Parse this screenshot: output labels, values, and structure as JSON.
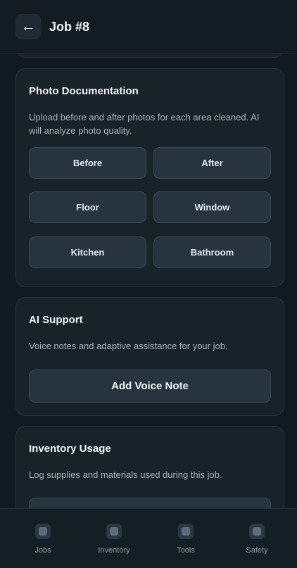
{
  "header": {
    "back_icon": "←",
    "title": "Job #8"
  },
  "photo": {
    "title": "Photo Documentation",
    "description": "Upload before and after photos for each area cleaned. AI will analyze photo quality.",
    "buttons": [
      "Before",
      "After",
      "Floor",
      "Window",
      "Kitchen",
      "Bathroom"
    ]
  },
  "ai": {
    "title": "AI Support",
    "description": "Voice notes and adaptive assistance for your job.",
    "button": "Add Voice Note"
  },
  "inventory": {
    "title": "Inventory Usage",
    "description": "Log supplies and materials used during this job."
  },
  "nav": {
    "items": [
      {
        "label": "Jobs",
        "icon": "jobs-icon"
      },
      {
        "label": "Inventory",
        "icon": "inventory-icon"
      },
      {
        "label": "Tools",
        "icon": "tools-icon"
      },
      {
        "label": "Safety",
        "icon": "safety-icon"
      }
    ]
  }
}
